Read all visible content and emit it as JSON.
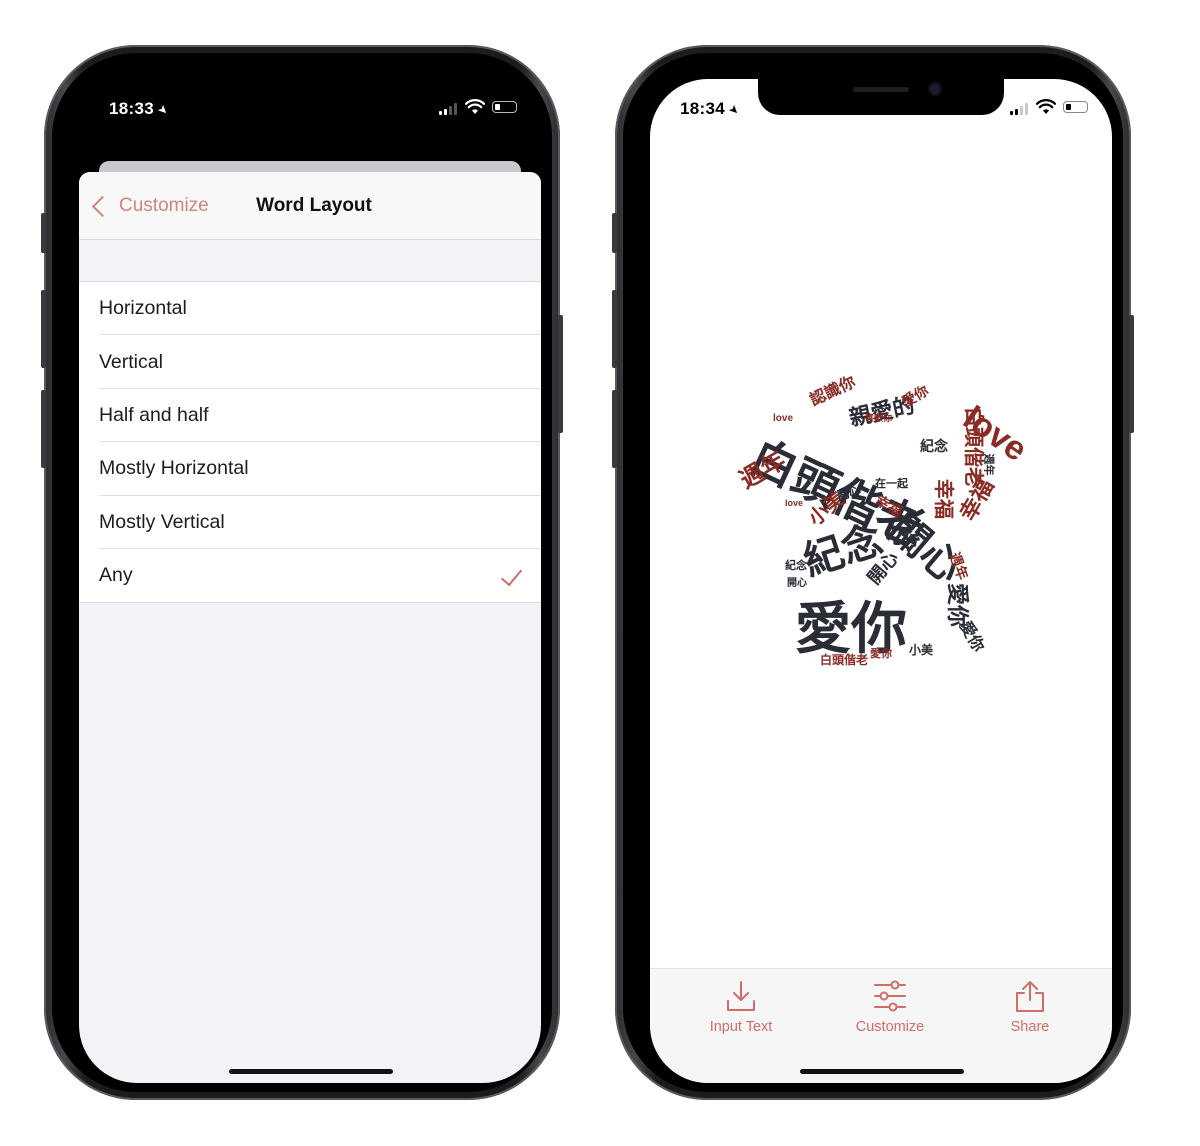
{
  "left_phone": {
    "status": {
      "time": "18:33"
    },
    "nav": {
      "back_label": "Customize",
      "title": "Word Layout"
    },
    "options": [
      {
        "label": "Horizontal",
        "selected": false
      },
      {
        "label": "Vertical",
        "selected": false
      },
      {
        "label": "Half and half",
        "selected": false
      },
      {
        "label": "Mostly Horizontal",
        "selected": false
      },
      {
        "label": "Mostly Vertical",
        "selected": false
      },
      {
        "label": "Any",
        "selected": true
      }
    ]
  },
  "right_phone": {
    "status": {
      "time": "18:34"
    },
    "word_cloud": {
      "shape": "t-shirt",
      "words": [
        "白頭偕老",
        "愛你",
        "紀念",
        "關心",
        "親愛的",
        "love",
        "週年",
        "幸福",
        "小美",
        "認識你",
        "開心",
        "在一起",
        "喜歡你"
      ]
    },
    "tabs": [
      {
        "label": "Input Text",
        "icon": "download-icon"
      },
      {
        "label": "Customize",
        "icon": "sliders-icon"
      },
      {
        "label": "Share",
        "icon": "share-icon"
      }
    ]
  },
  "colors": {
    "accent": "#d06c68",
    "cloud_dark": "#2a2c36",
    "cloud_red": "#8a2b24"
  }
}
